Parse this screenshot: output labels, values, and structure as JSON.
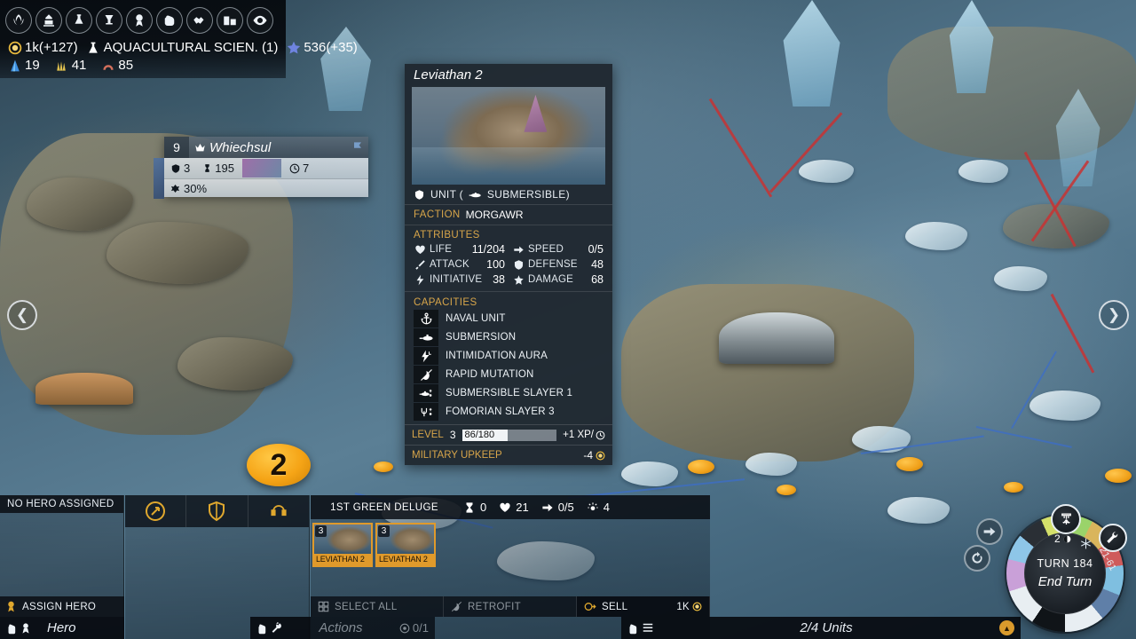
{
  "top_hud": {
    "nav_icons": [
      {
        "name": "laurel-victory-icon",
        "glyph": "⚜"
      },
      {
        "name": "capitol-empire-icon",
        "glyph": "⛪"
      },
      {
        "name": "research-flask-icon",
        "glyph": "⚗"
      },
      {
        "name": "quest-chalice-icon",
        "glyph": "☥"
      },
      {
        "name": "medal-award-icon",
        "glyph": "⚈"
      },
      {
        "name": "fist-military-icon",
        "glyph": "✊"
      },
      {
        "name": "handshake-diplomacy-icon",
        "glyph": "ᾑD"
      },
      {
        "name": "buildings-marketplace-icon",
        "glyph": "▤"
      },
      {
        "name": "eye-vision-icon",
        "glyph": "◉"
      }
    ],
    "resources_row1": [
      {
        "icon": "gold-coin-icon",
        "value": "1k(+127)",
        "color": "#e8b93d"
      },
      {
        "icon": "science-flask-icon",
        "value": "AQUACULTURAL SCIEN. (1)",
        "color": "#ffffff"
      },
      {
        "icon": "influence-star-icon",
        "value": "536(+35)",
        "color": "#6f84e0"
      }
    ],
    "resources_row2": [
      {
        "icon": "titanium-crystal-icon",
        "value": "19",
        "color": "#4da3e8"
      },
      {
        "icon": "glassteel-icon",
        "value": "41",
        "color": "#e2c24f"
      },
      {
        "icon": "adamantian-icon",
        "value": "85",
        "color": "#d4705c"
      }
    ]
  },
  "city_tooltip": {
    "population": "9",
    "name": "Whiechsul",
    "defense": "3",
    "production": "195",
    "turns": "7",
    "approval": "30%"
  },
  "unit_panel": {
    "title": "Leviathan 2",
    "type_label": "UNIT (",
    "type_sub": "SUBMERSIBLE)",
    "faction_label": "FACTION",
    "faction_value": "MORGAWR",
    "attributes_label": "ATTRIBUTES",
    "attributes": [
      {
        "icon": "heart-life-icon",
        "name": "LIFE",
        "value": "11/204"
      },
      {
        "icon": "arrow-speed-icon",
        "name": "SPEED",
        "value": "0/5"
      },
      {
        "icon": "sword-attack-icon",
        "name": "ATTACK",
        "value": "100"
      },
      {
        "icon": "shield-defense-icon",
        "name": "DEFENSE",
        "value": "48"
      },
      {
        "icon": "bolt-initiative-icon",
        "name": "INITIATIVE",
        "value": "38"
      },
      {
        "icon": "star-damage-icon",
        "name": "DAMAGE",
        "value": "68"
      }
    ],
    "capacities_label": "CAPACITIES",
    "capacities": [
      {
        "icon": "anchor-icon",
        "name": "NAVAL UNIT"
      },
      {
        "icon": "submarine-icon",
        "name": "SUBMERSION"
      },
      {
        "icon": "lightning-aura-icon",
        "name": "INTIMIDATION AURA"
      },
      {
        "icon": "mutation-icon",
        "name": "RAPID MUTATION"
      },
      {
        "icon": "submarine-slayer-icon",
        "name": "SUBMERSIBLE SLAYER 1"
      },
      {
        "icon": "trident-slayer-icon",
        "name": "FOMORIAN SLAYER 3"
      }
    ],
    "level_label": "LEVEL",
    "level_value": "3",
    "xp_value": "86/180",
    "xp_gain": "+1 XP/",
    "upkeep_label": "MILITARY UPKEEP",
    "upkeep_value": "-4"
  },
  "map": {
    "army_token": "2"
  },
  "hero_panel": {
    "no_hero": "NO HERO ASSIGNED",
    "assign_hero": "ASSIGN HERO",
    "footer_title": "Hero"
  },
  "actions_panel": {
    "buttons": [
      {
        "name": "move-action-button",
        "icon": "compass-arrow-icon"
      },
      {
        "name": "fortify-action-button",
        "icon": "shield-icon"
      },
      {
        "name": "swap-action-button",
        "icon": "swap-units-icon"
      }
    ],
    "footer_title": "Actions",
    "footer_count": "0/1"
  },
  "army_panel": {
    "name": "1ST GREEN DELUGE",
    "stats": [
      {
        "icon": "hourglass-icon",
        "value": "0"
      },
      {
        "icon": "heart-icon",
        "value": "21"
      },
      {
        "icon": "movement-arrow-icon",
        "value": "0/5"
      },
      {
        "icon": "vision-eye-icon",
        "value": "4"
      }
    ],
    "units": [
      {
        "level": "3",
        "name": "LEVIATHAN 2"
      },
      {
        "level": "3",
        "name": "LEVIATHAN 2"
      }
    ],
    "actions": [
      {
        "name": "select-all-button",
        "label": "SELECT ALL",
        "icon": "grid-icon",
        "state": "dim"
      },
      {
        "name": "retrofit-button",
        "label": "RETROFIT",
        "icon": "retrofit-icon",
        "state": "dim"
      },
      {
        "name": "sell-button",
        "label": "SELL",
        "icon": "sell-coin-icon",
        "state": "active",
        "cost": "1K"
      }
    ],
    "footer_title": "2/4 Units"
  },
  "turn_wheel": {
    "turn_label": "TURN 184",
    "end_turn_label": "End Turn",
    "season_icon": "winter-season-icon",
    "season_count": "2",
    "tools_icon": "wrench-tools-icon",
    "tools_count": "21-61",
    "next_unit_icon": "arrow-right-icon",
    "cycle_icon": "cycle-refresh-icon"
  },
  "side_nav": {
    "left_icon": "chevron-left-icon",
    "right_icon": "chevron-right-icon"
  }
}
